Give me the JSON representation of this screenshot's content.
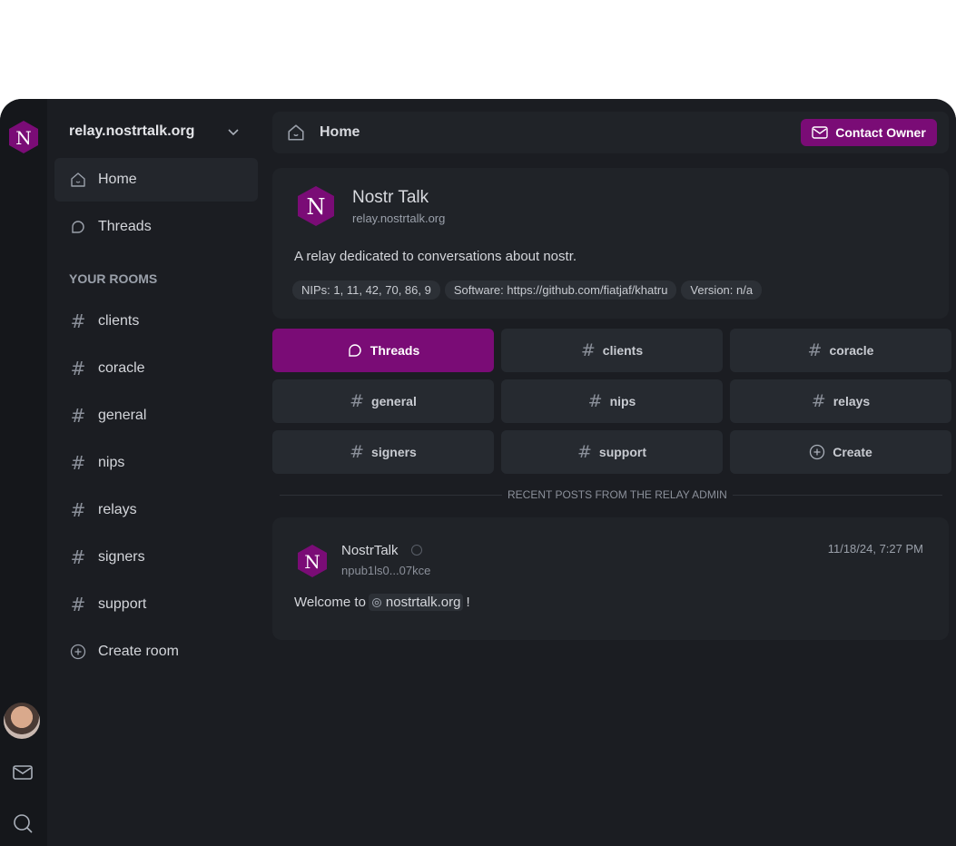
{
  "colors": {
    "accent": "#7a0c76",
    "background": "#1b1d22",
    "panel": "#202328"
  },
  "sidebar": {
    "relay_name": "relay.nostrtalk.org",
    "nav": [
      {
        "label": "Home",
        "icon": "home-icon",
        "active": true
      },
      {
        "label": "Threads",
        "icon": "threads-icon",
        "active": false
      }
    ],
    "rooms_title": "YOUR ROOMS",
    "rooms": [
      "clients",
      "coracle",
      "general",
      "nips",
      "relays",
      "signers",
      "support"
    ],
    "create_room": "Create room"
  },
  "topbar": {
    "title": "Home",
    "contact_label": "Contact Owner"
  },
  "relay_card": {
    "name": "Nostr Talk",
    "url": "relay.nostrtalk.org",
    "description": "A relay dedicated to conversations about nostr.",
    "tags": [
      "NIPs: 1, 11, 42, 70, 86, 9",
      "Software: https://github.com/fiatjaf/khatru",
      "Version: n/a"
    ]
  },
  "room_grid": {
    "threads_label": "Threads",
    "rooms": [
      "clients",
      "coracle",
      "general",
      "nips",
      "relays",
      "signers",
      "support"
    ],
    "create_label": "Create"
  },
  "recent": {
    "section_label": "RECENT POSTS FROM THE RELAY ADMIN",
    "post": {
      "author": "NostrTalk",
      "npub": "npub1ls0...07kce",
      "timestamp": "11/18/24, 7:27 PM",
      "body_prefix": "Welcome to",
      "mention": "nostrtalk.org",
      "body_suffix": "!"
    }
  }
}
